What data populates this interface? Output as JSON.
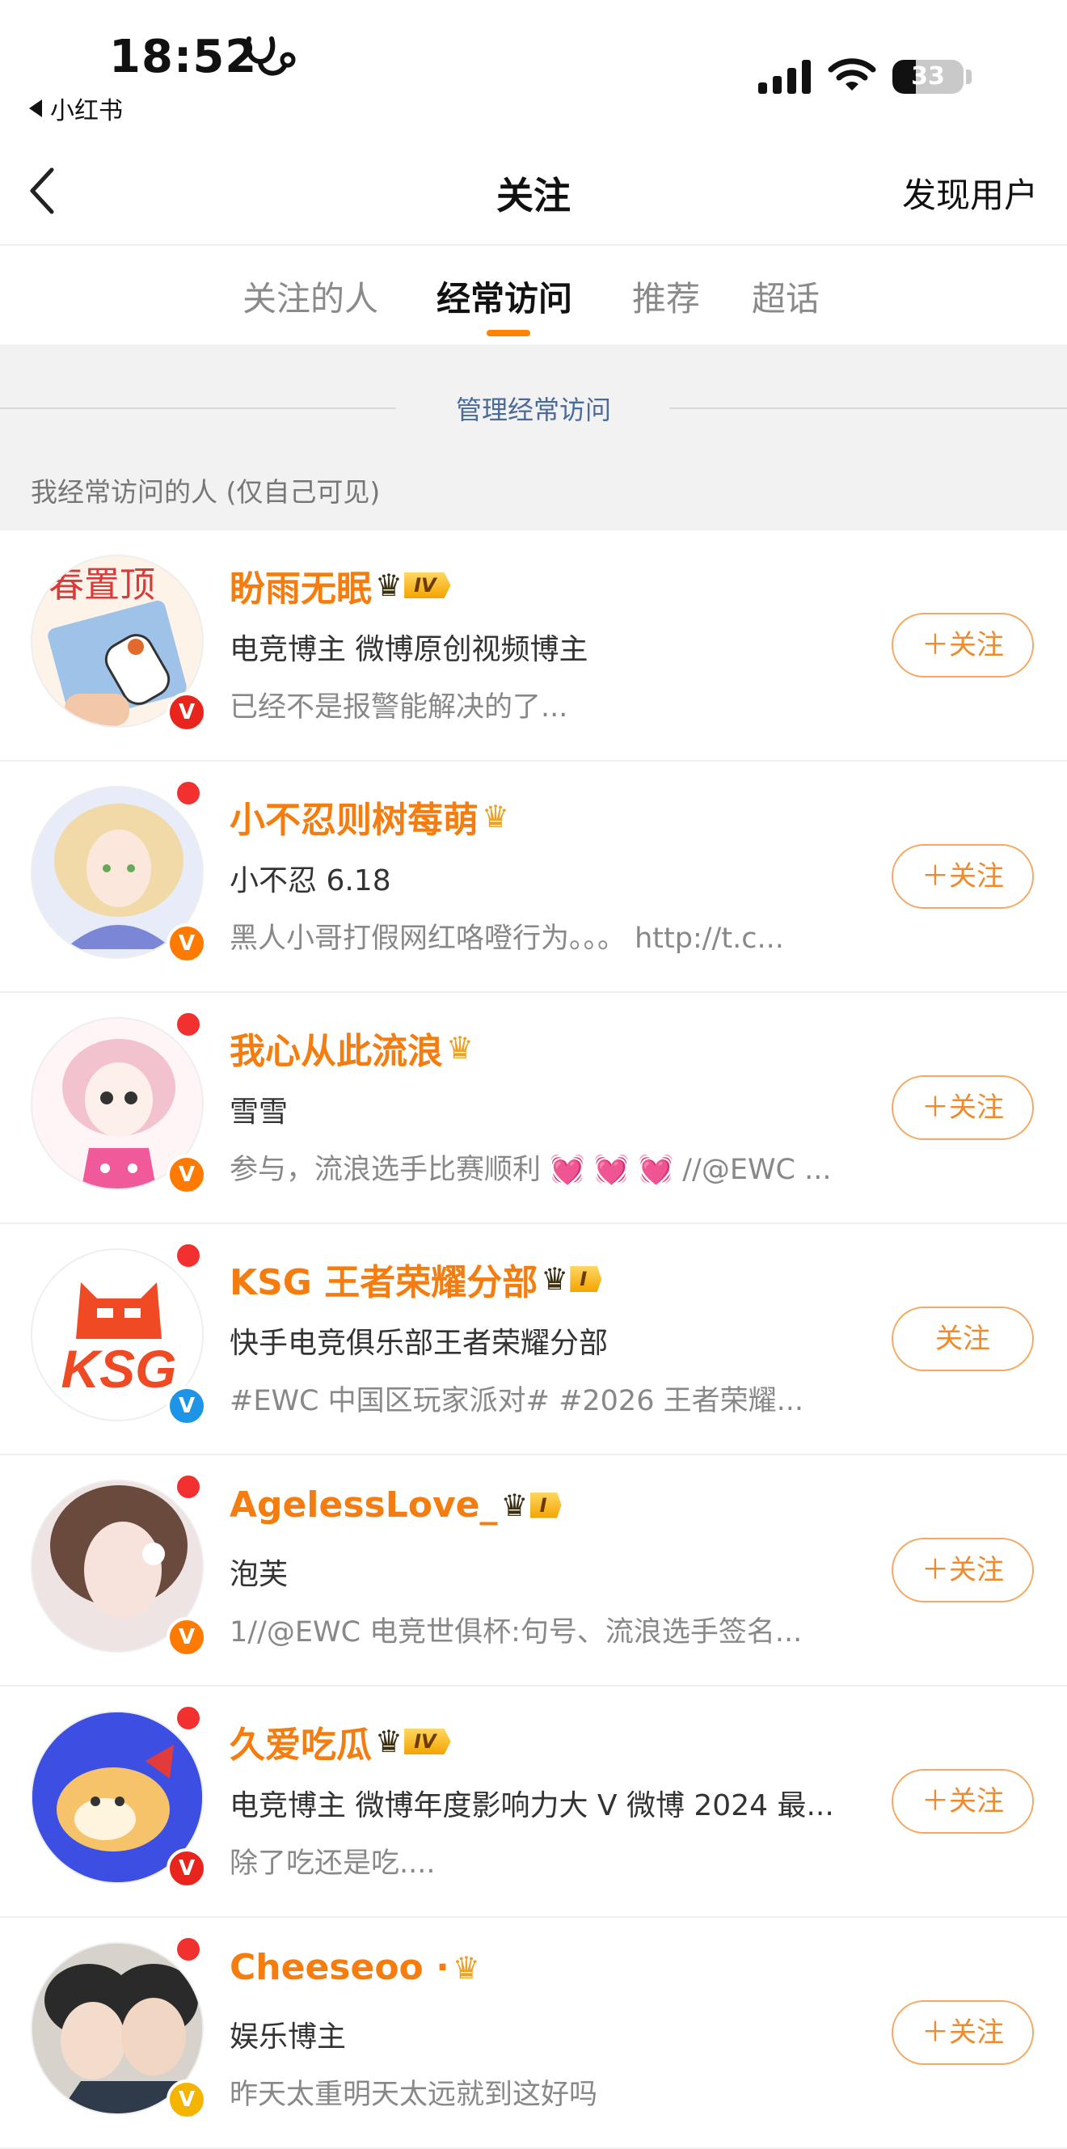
{
  "status_bar": {
    "time": "18:52",
    "back_app": "小红书",
    "battery": "33"
  },
  "nav": {
    "title": "关注",
    "right_action": "发现用户"
  },
  "tabs": [
    {
      "label": "关注的人",
      "active": false
    },
    {
      "label": "经常访问",
      "active": true
    },
    {
      "label": "推荐",
      "active": false
    },
    {
      "label": "超话",
      "active": false
    }
  ],
  "section": {
    "manage_link": "管理经常访问",
    "caption": "我经常访问的人 (仅自己可见)"
  },
  "users": [
    {
      "name": "盼雨无眠",
      "level": "IV",
      "line2": "电竞博主 微博原创视频博主",
      "line3": "已经不是报警能解决的了...",
      "badge": "red",
      "dot": false,
      "follow": "＋关注"
    },
    {
      "name": "小不忍则树莓萌",
      "level": "",
      "line2": "小不忍 6.18",
      "line3": "黑人小哥打假网红咯噔行为。。。 http://t.c...",
      "badge": "orange",
      "dot": true,
      "follow": "＋关注"
    },
    {
      "name": "我心从此流浪",
      "level": "",
      "line2": "雪雪",
      "line3": "参与，流浪选手比赛顺利 💓 💓 💓 //@EWC ...",
      "badge": "orange",
      "dot": true,
      "follow": "＋关注"
    },
    {
      "name": "KSG 王者荣耀分部",
      "level": "I",
      "line2": "快手电竞俱乐部王者荣耀分部",
      "line3": "#EWC 中国区玩家派对# #2026 王者荣耀...",
      "badge": "blue",
      "dot": true,
      "follow": "关注"
    },
    {
      "name": "AgelessLove_",
      "level": "I",
      "line2": "泡芙",
      "line3": "1//@EWC 电竞世俱杯:句号、流浪选手签名...",
      "badge": "orange",
      "dot": true,
      "follow": "＋关注"
    },
    {
      "name": "久爱吃瓜",
      "level": "IV",
      "line2": "电竞博主 微博年度影响力大 V 微博 2024 最...",
      "line3": "除了吃还是吃....",
      "badge": "red",
      "dot": true,
      "follow": "＋关注"
    },
    {
      "name": "Cheeseoo ·",
      "level": "",
      "line2": "娱乐博主",
      "line3": "昨天太重明天太远就到这好吗",
      "badge": "gold",
      "dot": true,
      "follow": "＋关注"
    }
  ]
}
